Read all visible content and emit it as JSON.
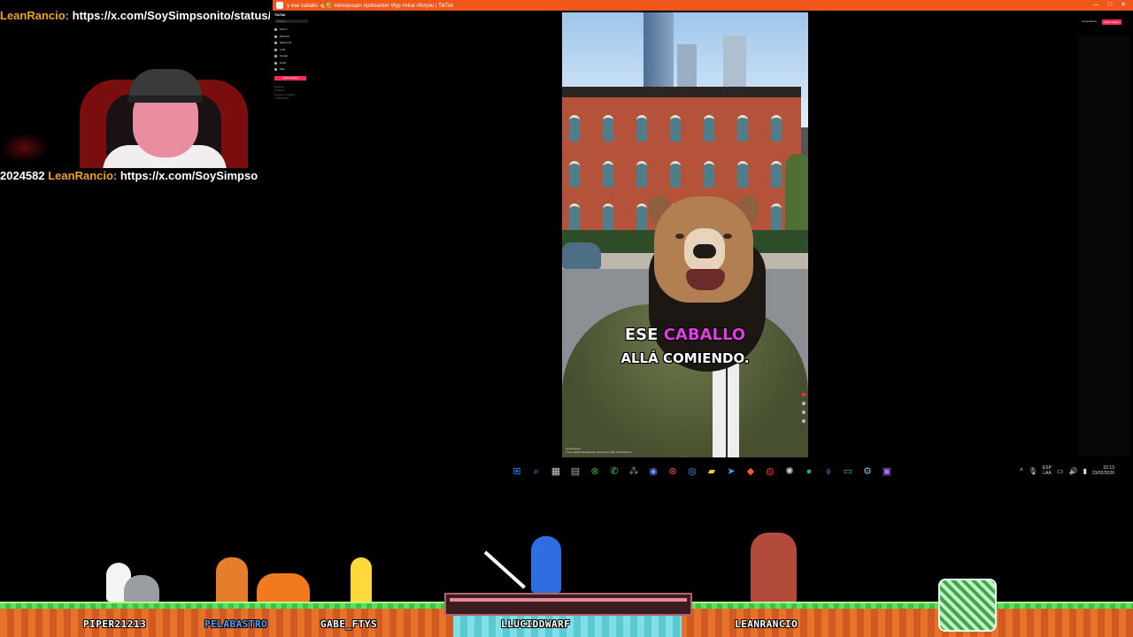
{
  "browser": {
    "title": "y ese caballo 🐴🤣 #elviejosam #pdreamer #fyp #viral #foryou | TikTok",
    "controls": [
      "—",
      "□",
      "✕"
    ]
  },
  "tiktok": {
    "logo": "TikTok",
    "search_placeholder": "Buscar",
    "nav": [
      "Para ti",
      "Explorar",
      "Siguiendo",
      "LIVE",
      "Cargar",
      "Perfil",
      "Más"
    ],
    "login_label": "Iniciar sesión",
    "footer": [
      "Empresa",
      "Programa",
      "Términos y políticas",
      "© 2026 TikTok"
    ],
    "header_link": "Comentarios",
    "header_button": "Iniciar sesión"
  },
  "video": {
    "subtitle_line1_a": "ESE ",
    "subtitle_line1_b": "CABALLO",
    "subtitle_line2": "ALLÁ COMIENDO.",
    "caption_user": "@elviejosam",
    "caption_text": "y ese caballo #elviejosam #pdreamer #fyp #viral #foryou"
  },
  "overlay": {
    "chat1_user": "LeanRancio:",
    "chat1_text": " https://x.com/SoySimpsonito/status/",
    "chat2_prefix": "2024582 ",
    "chat2_user": "LeanRancio:",
    "chat2_text": " https://x.com/SoySimpso"
  },
  "taskbar": {
    "apps": [
      {
        "name": "start-icon",
        "glyph": "⊞",
        "color": "#1e90ff"
      },
      {
        "name": "search-icon",
        "glyph": "⌕",
        "color": "#4aa3ff"
      },
      {
        "name": "file-icon",
        "glyph": "▦",
        "color": "#cccccc"
      },
      {
        "name": "calendar-icon",
        "glyph": "▤",
        "color": "#aaaaaa"
      },
      {
        "name": "xbox-icon",
        "glyph": "⊗",
        "color": "#2fa84a"
      },
      {
        "name": "whatsapp-icon",
        "glyph": "✆",
        "color": "#25d366"
      },
      {
        "name": "grid-icon",
        "glyph": "⁂",
        "color": "#888888"
      },
      {
        "name": "discord-icon",
        "glyph": "◉",
        "color": "#7b8cff"
      },
      {
        "name": "app-red-icon",
        "glyph": "⊛",
        "color": "#ff4466"
      },
      {
        "name": "chrome-icon",
        "glyph": "◎",
        "color": "#4aa3ff"
      },
      {
        "name": "folder-icon",
        "glyph": "▰",
        "color": "#ffcc33"
      },
      {
        "name": "telegram-icon",
        "glyph": "➤",
        "color": "#37a7e3"
      },
      {
        "name": "brave-icon",
        "glyph": "◆",
        "color": "#ff5a2c"
      },
      {
        "name": "obs-icon",
        "glyph": "◍",
        "color": "#e0303a"
      },
      {
        "name": "openai-icon",
        "glyph": "✺",
        "color": "#cccccc"
      },
      {
        "name": "spotify-icon",
        "glyph": "●",
        "color": "#1db954"
      },
      {
        "name": "arrow-icon",
        "glyph": "⬨",
        "color": "#4aa3ff"
      },
      {
        "name": "terminal-icon",
        "glyph": "▭",
        "color": "#2fcf8a"
      },
      {
        "name": "steam-icon",
        "glyph": "⚙",
        "color": "#8fb8d8"
      },
      {
        "name": "twitch-icon",
        "glyph": "▣",
        "color": "#a970ff"
      }
    ],
    "tray_chevron": "^",
    "lang_top": "ESP",
    "lang_bottom": "LAA",
    "time": "22:13",
    "date": "23/02/2026"
  },
  "game": {
    "players": [
      "PIPER21213",
      "PELABASTRO",
      "GABE_FTYS",
      "LLUCIDDWARF",
      "LEANRANCIO"
    ]
  }
}
